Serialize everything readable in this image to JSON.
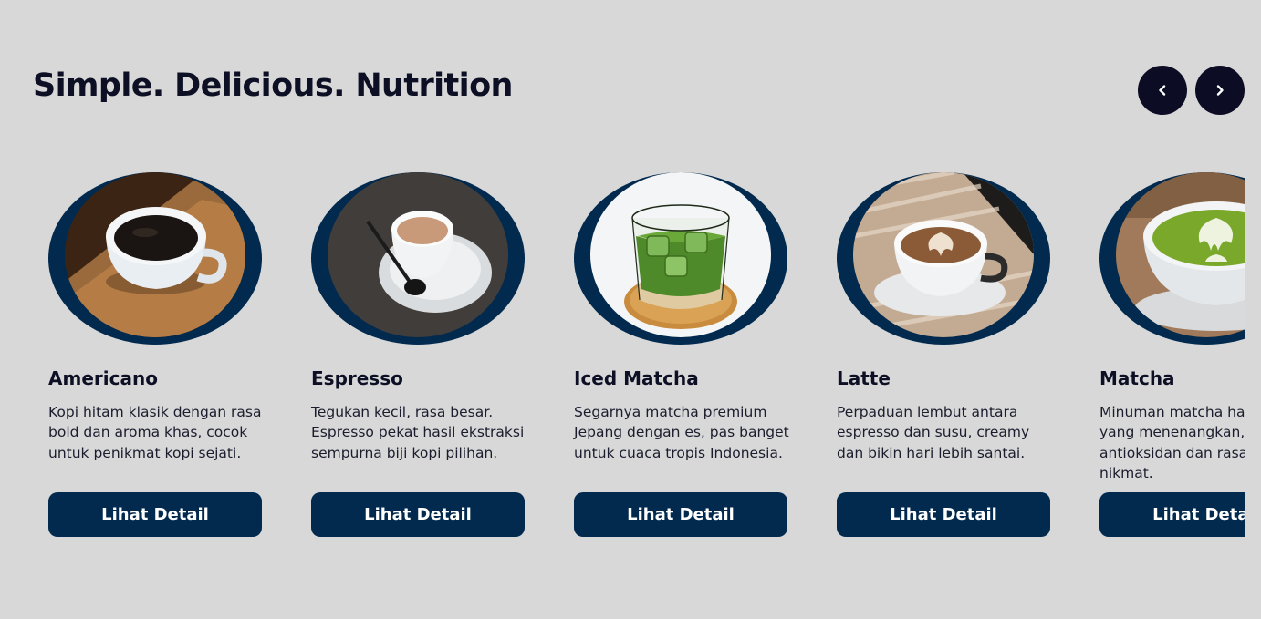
{
  "section": {
    "title": "Simple. Delicious. Nutrition"
  },
  "nav": {
    "prev_icon": "chevron-left-icon",
    "next_icon": "chevron-right-icon"
  },
  "colors": {
    "page_background": "#d8d8d8",
    "accent": "#022a4f",
    "nav_button": "#0c0c24",
    "heading": "#0d0f24"
  },
  "products": [
    {
      "name": "Americano",
      "description": "Kopi hitam klasik dengan rasa bold dan aroma khas, cocok untuk penikmat kopi sejati.",
      "button_label": "Lihat Detail"
    },
    {
      "name": "Espresso",
      "description": "Tegukan kecil, rasa besar. Espresso pekat hasil ekstraksi sempurna biji kopi pilihan.",
      "button_label": "Lihat Detail"
    },
    {
      "name": "Iced Matcha",
      "description": "Segarnya matcha premium Jepang dengan es, pas banget untuk cuaca tropis Indonesia.",
      "button_label": "Lihat Detail"
    },
    {
      "name": "Latte",
      "description": "Perpaduan lembut antara espresso dan susu, creamy dan bikin hari lebih santai.",
      "button_label": "Lihat Detail"
    },
    {
      "name": "Matcha",
      "description": "Minuman matcha hangat yang menenangkan, kaya antioksidan dan rasa yang nikmat.",
      "button_label": "Lihat Detail"
    }
  ]
}
